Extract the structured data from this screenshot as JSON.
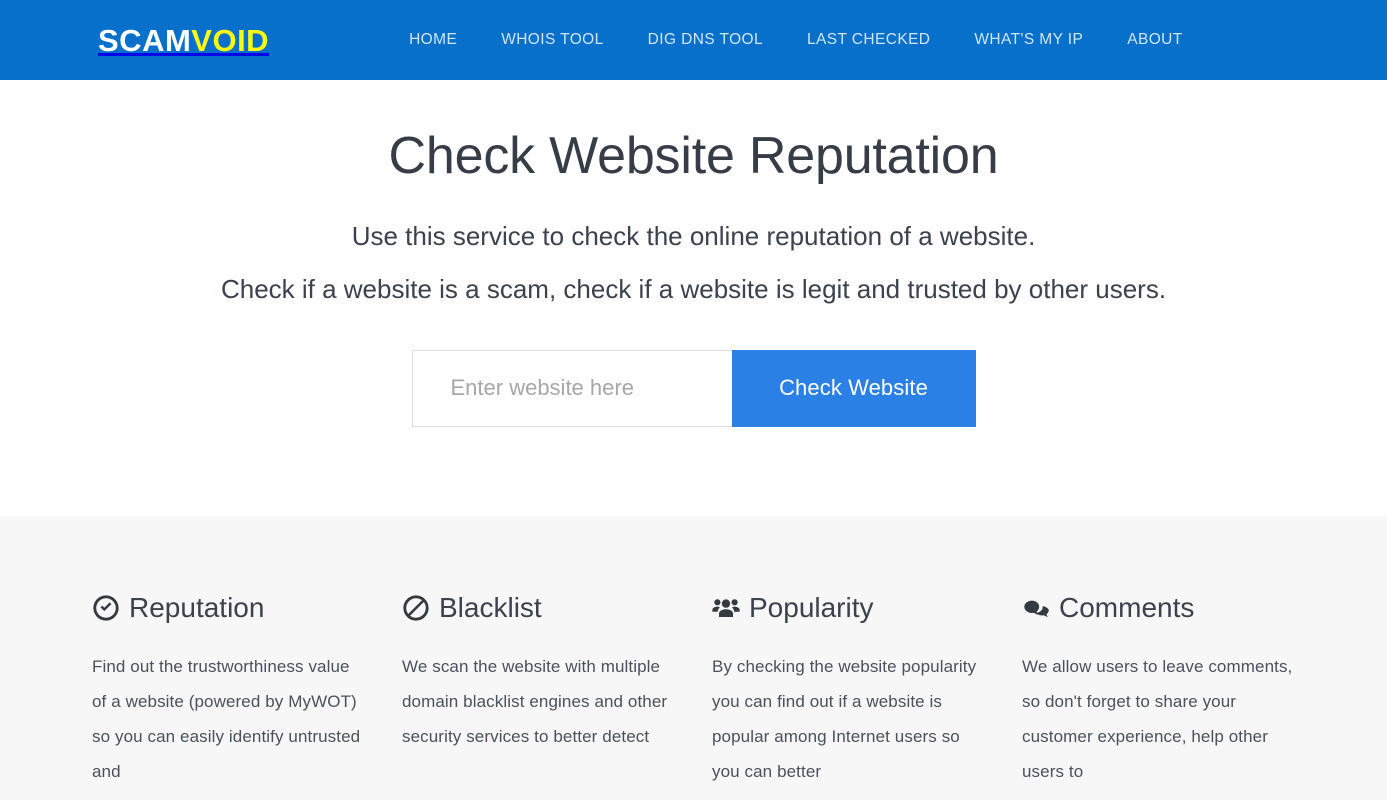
{
  "header": {
    "brand_part1": "SCAM",
    "brand_part2": "VOID",
    "brand_color_1": "#ffffff",
    "brand_color_2": "#fbf811",
    "background_color": "#0770ca",
    "nav": [
      {
        "label": "HOME",
        "name": "nav-home"
      },
      {
        "label": "WHOIS TOOL",
        "name": "nav-whois-tool"
      },
      {
        "label": "DIG DNS TOOL",
        "name": "nav-dig-dns-tool"
      },
      {
        "label": "LAST CHECKED",
        "name": "nav-last-checked"
      },
      {
        "label": "WHAT'S MY IP",
        "name": "nav-whats-my-ip"
      },
      {
        "label": "ABOUT",
        "name": "nav-about"
      }
    ]
  },
  "hero": {
    "title": "Check Website Reputation",
    "subtitle_line1": "Use this service to check the online reputation of a website.",
    "subtitle_line2": "Check if a website is a scam, check if a website is legit and trusted by other users."
  },
  "search": {
    "placeholder": "Enter website here",
    "value": "",
    "button_label": "Check Website",
    "button_color": "#2a80e4"
  },
  "features": {
    "background_color": "#f7f7f7",
    "items": [
      {
        "icon": "check-circle-icon",
        "title": "Reputation",
        "text": "Find out the trustworthiness value of a website (powered by MyWOT) so you can easily identify untrusted and"
      },
      {
        "icon": "ban-icon",
        "title": "Blacklist",
        "text": "We scan the website with multiple domain blacklist engines and other security services to better detect"
      },
      {
        "icon": "users-icon",
        "title": "Popularity",
        "text": "By checking the website popularity you can find out if a website is popular among Internet users so you can better"
      },
      {
        "icon": "comments-icon",
        "title": "Comments",
        "text": "We allow users to leave comments, so don't forget to share your customer experience, help other users to"
      }
    ]
  }
}
